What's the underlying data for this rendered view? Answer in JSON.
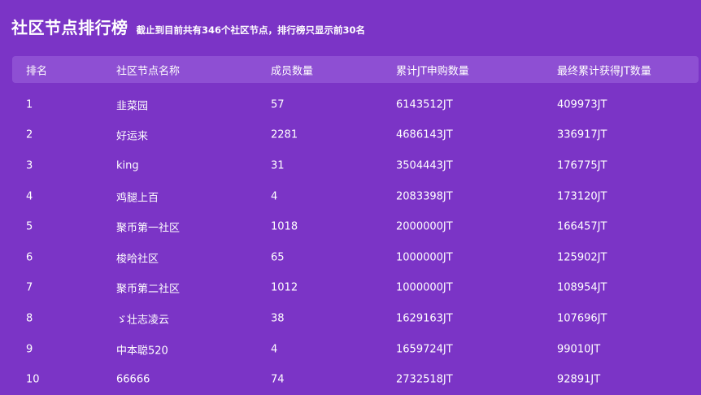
{
  "header": {
    "title": "社区节点排行榜",
    "subtitle": "截止到目前共有346个社区节点，排行榜只显示前30名"
  },
  "table": {
    "columns": [
      "排名",
      "社区节点名称",
      "成员数量",
      "累计JT申购数量",
      "最终累计获得JT数量"
    ],
    "rows": [
      [
        "1",
        "韭菜园",
        "57",
        "6143512JT",
        "409973JT"
      ],
      [
        "2",
        "好运来",
        "2281",
        "4686143JT",
        "336917JT"
      ],
      [
        "3",
        "king",
        "31",
        "3504443JT",
        "176775JT"
      ],
      [
        "4",
        "鸡腿上百",
        "4",
        "2083398JT",
        "173120JT"
      ],
      [
        "5",
        "聚币第一社区",
        "1018",
        "2000000JT",
        "166457JT"
      ],
      [
        "6",
        "梭哈社区",
        "65",
        "1000000JT",
        "125902JT"
      ],
      [
        "7",
        "聚币第二社区",
        "1012",
        "1000000JT",
        "108954JT"
      ],
      [
        "8",
        "ゞ壮志凌云",
        "38",
        "1629163JT",
        "107696JT"
      ],
      [
        "9",
        "中本聪520",
        "4",
        "1659724JT",
        "99010JT"
      ],
      [
        "10",
        "66666",
        "74",
        "2732518JT",
        "92891JT"
      ]
    ]
  }
}
